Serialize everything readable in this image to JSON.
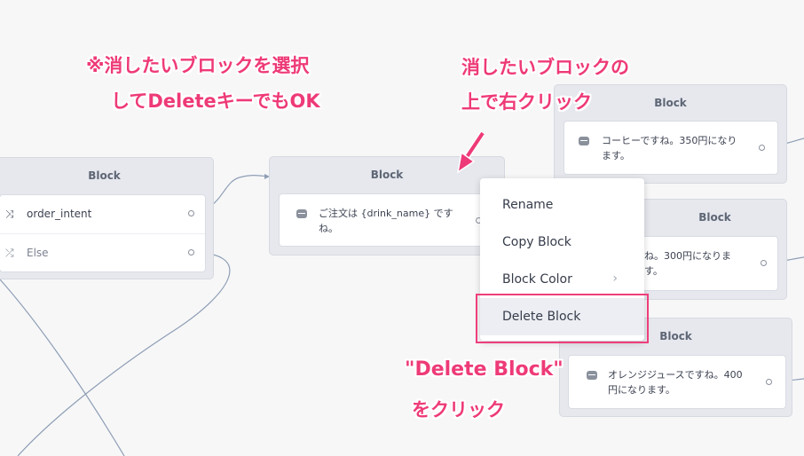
{
  "blocks": {
    "left": {
      "title": "Block",
      "rows": [
        {
          "icon": "split-icon",
          "label": "order_intent"
        },
        {
          "icon": "else-icon",
          "label": "Else"
        }
      ]
    },
    "middle": {
      "title": "Block",
      "message_line1": "ご注文は {drink_name} です",
      "message_line2": "ね。"
    },
    "right_top": {
      "title": "Block",
      "message_line1": "コーヒーですね。350円になり",
      "message_line2": "ます。"
    },
    "right_mid": {
      "title": "Block",
      "message_line1": "ね。300円になりま",
      "message_line2": "す。"
    },
    "right_bottom": {
      "title": "Block",
      "message_line1": "オレンジジュースですね。400",
      "message_line2": "円になります。"
    }
  },
  "context_menu": {
    "items": [
      {
        "label": "Rename"
      },
      {
        "label": "Copy Block"
      },
      {
        "label": "Block Color",
        "submenu": true
      },
      {
        "label": "Delete Block",
        "highlighted": true
      }
    ]
  },
  "annotations": {
    "top_left_line1": "※消したいブロックを選択",
    "top_left_line2": "してDeleteキーでもOK",
    "top_right_line1": "消したいブロックの",
    "top_right_line2": "上で右クリック",
    "bottom_line1": "\"Delete Block\"",
    "bottom_line2": "をクリック"
  },
  "colors": {
    "annotation": "#ee3a78",
    "background": "#f7f7f8",
    "block": "#e6e8ee"
  }
}
